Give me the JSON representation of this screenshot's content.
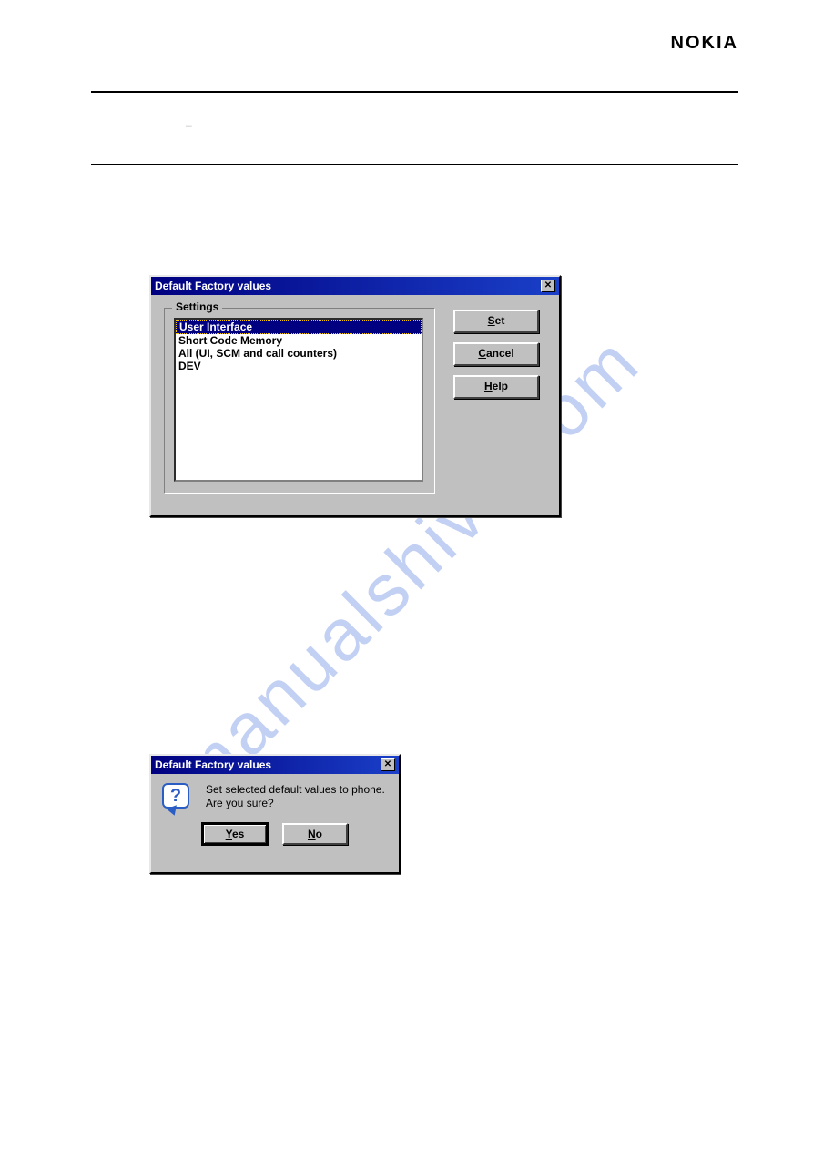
{
  "brand": "NOKIA",
  "subhead_dash": "–",
  "watermark": "manualshive.com",
  "dialog1": {
    "title": "Default Factory values",
    "close_glyph": "✕",
    "legend": "Settings",
    "items": [
      "User Interface",
      "Short Code Memory",
      "All (UI, SCM and call counters)",
      "DEV"
    ],
    "buttons": {
      "set": {
        "pre": "",
        "u": "S",
        "rest": "et"
      },
      "cancel": {
        "pre": "",
        "u": "C",
        "rest": "ancel"
      },
      "help": {
        "pre": "",
        "u": "H",
        "rest": "elp"
      }
    }
  },
  "dialog2": {
    "title": "Default Factory values",
    "close_glyph": "✕",
    "qmark": "?",
    "line1": "Set selected default values to phone.",
    "line2": "Are you sure?",
    "buttons": {
      "yes": {
        "pre": "",
        "u": "Y",
        "rest": "es"
      },
      "no": {
        "pre": "",
        "u": "N",
        "rest": "o"
      }
    }
  }
}
